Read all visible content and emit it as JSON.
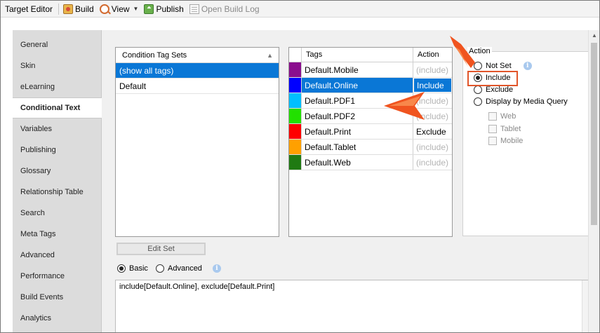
{
  "toolbar": {
    "title": "Target Editor",
    "build": "Build",
    "view": "View",
    "publish": "Publish",
    "open_build_log": "Open Build Log"
  },
  "sidebar": {
    "items": [
      {
        "label": "General"
      },
      {
        "label": "Skin"
      },
      {
        "label": "eLearning"
      },
      {
        "label": "Conditional Text",
        "active": true
      },
      {
        "label": "Variables"
      },
      {
        "label": "Publishing"
      },
      {
        "label": "Glossary"
      },
      {
        "label": "Relationship Table"
      },
      {
        "label": "Search"
      },
      {
        "label": "Meta Tags"
      },
      {
        "label": "Advanced"
      },
      {
        "label": "Performance"
      },
      {
        "label": "Build Events"
      },
      {
        "label": "Analytics"
      }
    ]
  },
  "tag_sets": {
    "header": "Condition Tag Sets",
    "rows": [
      "(show all tags)",
      "Default"
    ],
    "selected_index": 0
  },
  "tags_grid": {
    "col_tags": "Tags",
    "col_action": "Action",
    "rows": [
      {
        "name": "Default.Mobile",
        "action": "(include)",
        "color": "#8b0e8e"
      },
      {
        "name": "Default.Online",
        "action": "Include",
        "color": "#0000ff",
        "selected": true
      },
      {
        "name": "Default.PDF1",
        "action": "(include)",
        "color": "#00bfff"
      },
      {
        "name": "Default.PDF2",
        "action": "(include)",
        "color": "#22e000"
      },
      {
        "name": "Default.Print",
        "action": "Exclude",
        "color": "#ff0000"
      },
      {
        "name": "Default.Tablet",
        "action": "(include)",
        "color": "#ffa000"
      },
      {
        "name": "Default.Web",
        "action": "(include)",
        "color": "#1f7a12"
      }
    ]
  },
  "action_group": {
    "title": "Action",
    "options": [
      "Not Set",
      "Include",
      "Exclude",
      "Display by Media Query"
    ],
    "selected": "Include",
    "media_queries": [
      "Web",
      "Tablet",
      "Mobile"
    ]
  },
  "edit_set_label": "Edit Set",
  "mode": {
    "basic": "Basic",
    "advanced": "Advanced",
    "selected": "Basic"
  },
  "expression": "include[Default.Online], exclude[Default.Print]",
  "colors": {
    "selection": "#0a77d6",
    "highlight": "#e1552a"
  }
}
